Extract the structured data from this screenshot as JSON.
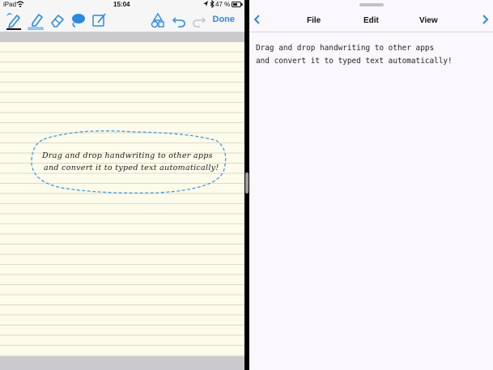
{
  "status": {
    "device": "iPad",
    "time": "15:04",
    "battery": "47 %"
  },
  "left_app": {
    "done_label": "Done",
    "tools": [
      "pen-tool",
      "highlighter-tool",
      "eraser-tool",
      "lasso-tool",
      "text-box-tool"
    ],
    "handwriting": {
      "line1": "Drag and drop handwriting to other apps",
      "line2": "and convert it to typed text automatically!"
    }
  },
  "right_app": {
    "menu": {
      "file": "File",
      "edit": "Edit",
      "view": "View"
    },
    "editor_text": "Drag and drop handwriting to other apps\nand convert it to typed text automatically!"
  },
  "colors": {
    "accent": "#2a8ae3",
    "paper": "#fdfbea",
    "selection": "#3f9be6"
  }
}
